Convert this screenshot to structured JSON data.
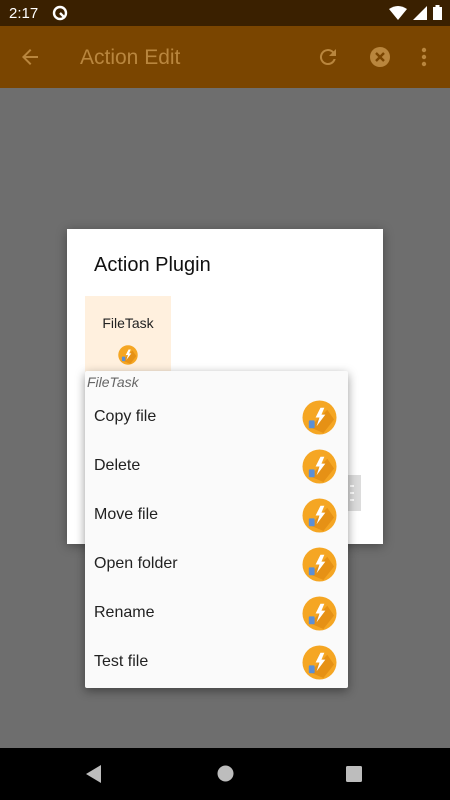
{
  "status_bar": {
    "time": "2:17",
    "left_icon": "notification-q-icon",
    "right_icons": [
      "wifi-icon",
      "cellular-signal-icon",
      "battery-icon"
    ]
  },
  "app_bar": {
    "title": "Action Edit",
    "color": "#7a4500",
    "icons": [
      "back-arrow-icon",
      "refresh-icon",
      "cancel-icon",
      "more-vert-icon"
    ]
  },
  "dialog": {
    "title": "Action Plugin",
    "plugin": {
      "label": "FileTask",
      "icon": "filetask-plugin-icon"
    }
  },
  "menu": {
    "header": "FileTask",
    "items": [
      {
        "label": "Copy file",
        "icon": "filetask-plugin-icon"
      },
      {
        "label": "Delete",
        "icon": "filetask-plugin-icon"
      },
      {
        "label": "Move file",
        "icon": "filetask-plugin-icon"
      },
      {
        "label": "Open folder",
        "icon": "filetask-plugin-icon"
      },
      {
        "label": "Rename",
        "icon": "filetask-plugin-icon"
      },
      {
        "label": "Test file",
        "icon": "filetask-plugin-icon"
      }
    ]
  },
  "nav_bar": {
    "icons": [
      "nav-back-icon",
      "nav-home-icon",
      "nav-recents-icon"
    ]
  },
  "colors": {
    "accent": "#f5a623",
    "app_bar": "#7a4500",
    "tile_highlight": "#fff0de"
  }
}
